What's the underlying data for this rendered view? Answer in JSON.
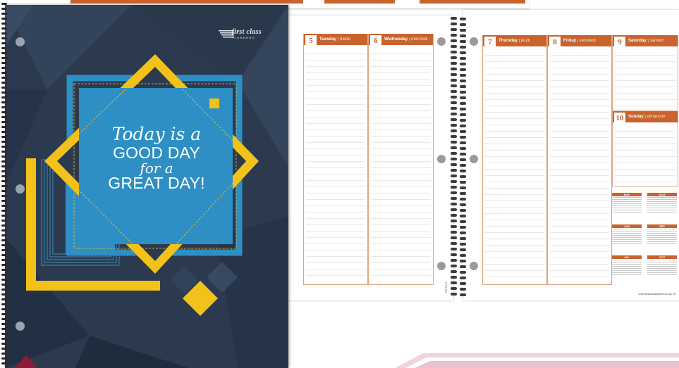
{
  "cover": {
    "brand_name": "first class",
    "brand_sub": "PLANNERS",
    "slogan_line1": "Today is a",
    "slogan_line2": "GOOD DAY",
    "slogan_line3": "for a",
    "slogan_line4": "GREAT DAY!"
  },
  "planner": {
    "left_days": [
      {
        "num": "5",
        "name": "Tuesday",
        "sub": "mardi"
      },
      {
        "num": "6",
        "name": "Wednesday",
        "sub": "mercredi"
      }
    ],
    "right_days": [
      {
        "num": "7",
        "name": "Thursday",
        "sub": "jeudi"
      },
      {
        "num": "8",
        "name": "Friday",
        "sub": "vendredi"
      },
      {
        "num": "9",
        "name": "Saturday",
        "sub": "samedi"
      },
      {
        "num": "10",
        "name": "Sunday",
        "sub": "dimanche"
      }
    ],
    "mini_months": [
      "MAY",
      "AUG",
      "JUN",
      "SEP",
      "JUL",
      "OCT"
    ],
    "footer_url": "www.firstclassplanners.ca",
    "page_number": "97",
    "side_code": "TSF2947"
  },
  "colors": {
    "accent": "#c9632e",
    "cover_bg": "#2c3a4f",
    "cover_blue": "#2e8fc4",
    "cover_yellow": "#f2c21b"
  }
}
